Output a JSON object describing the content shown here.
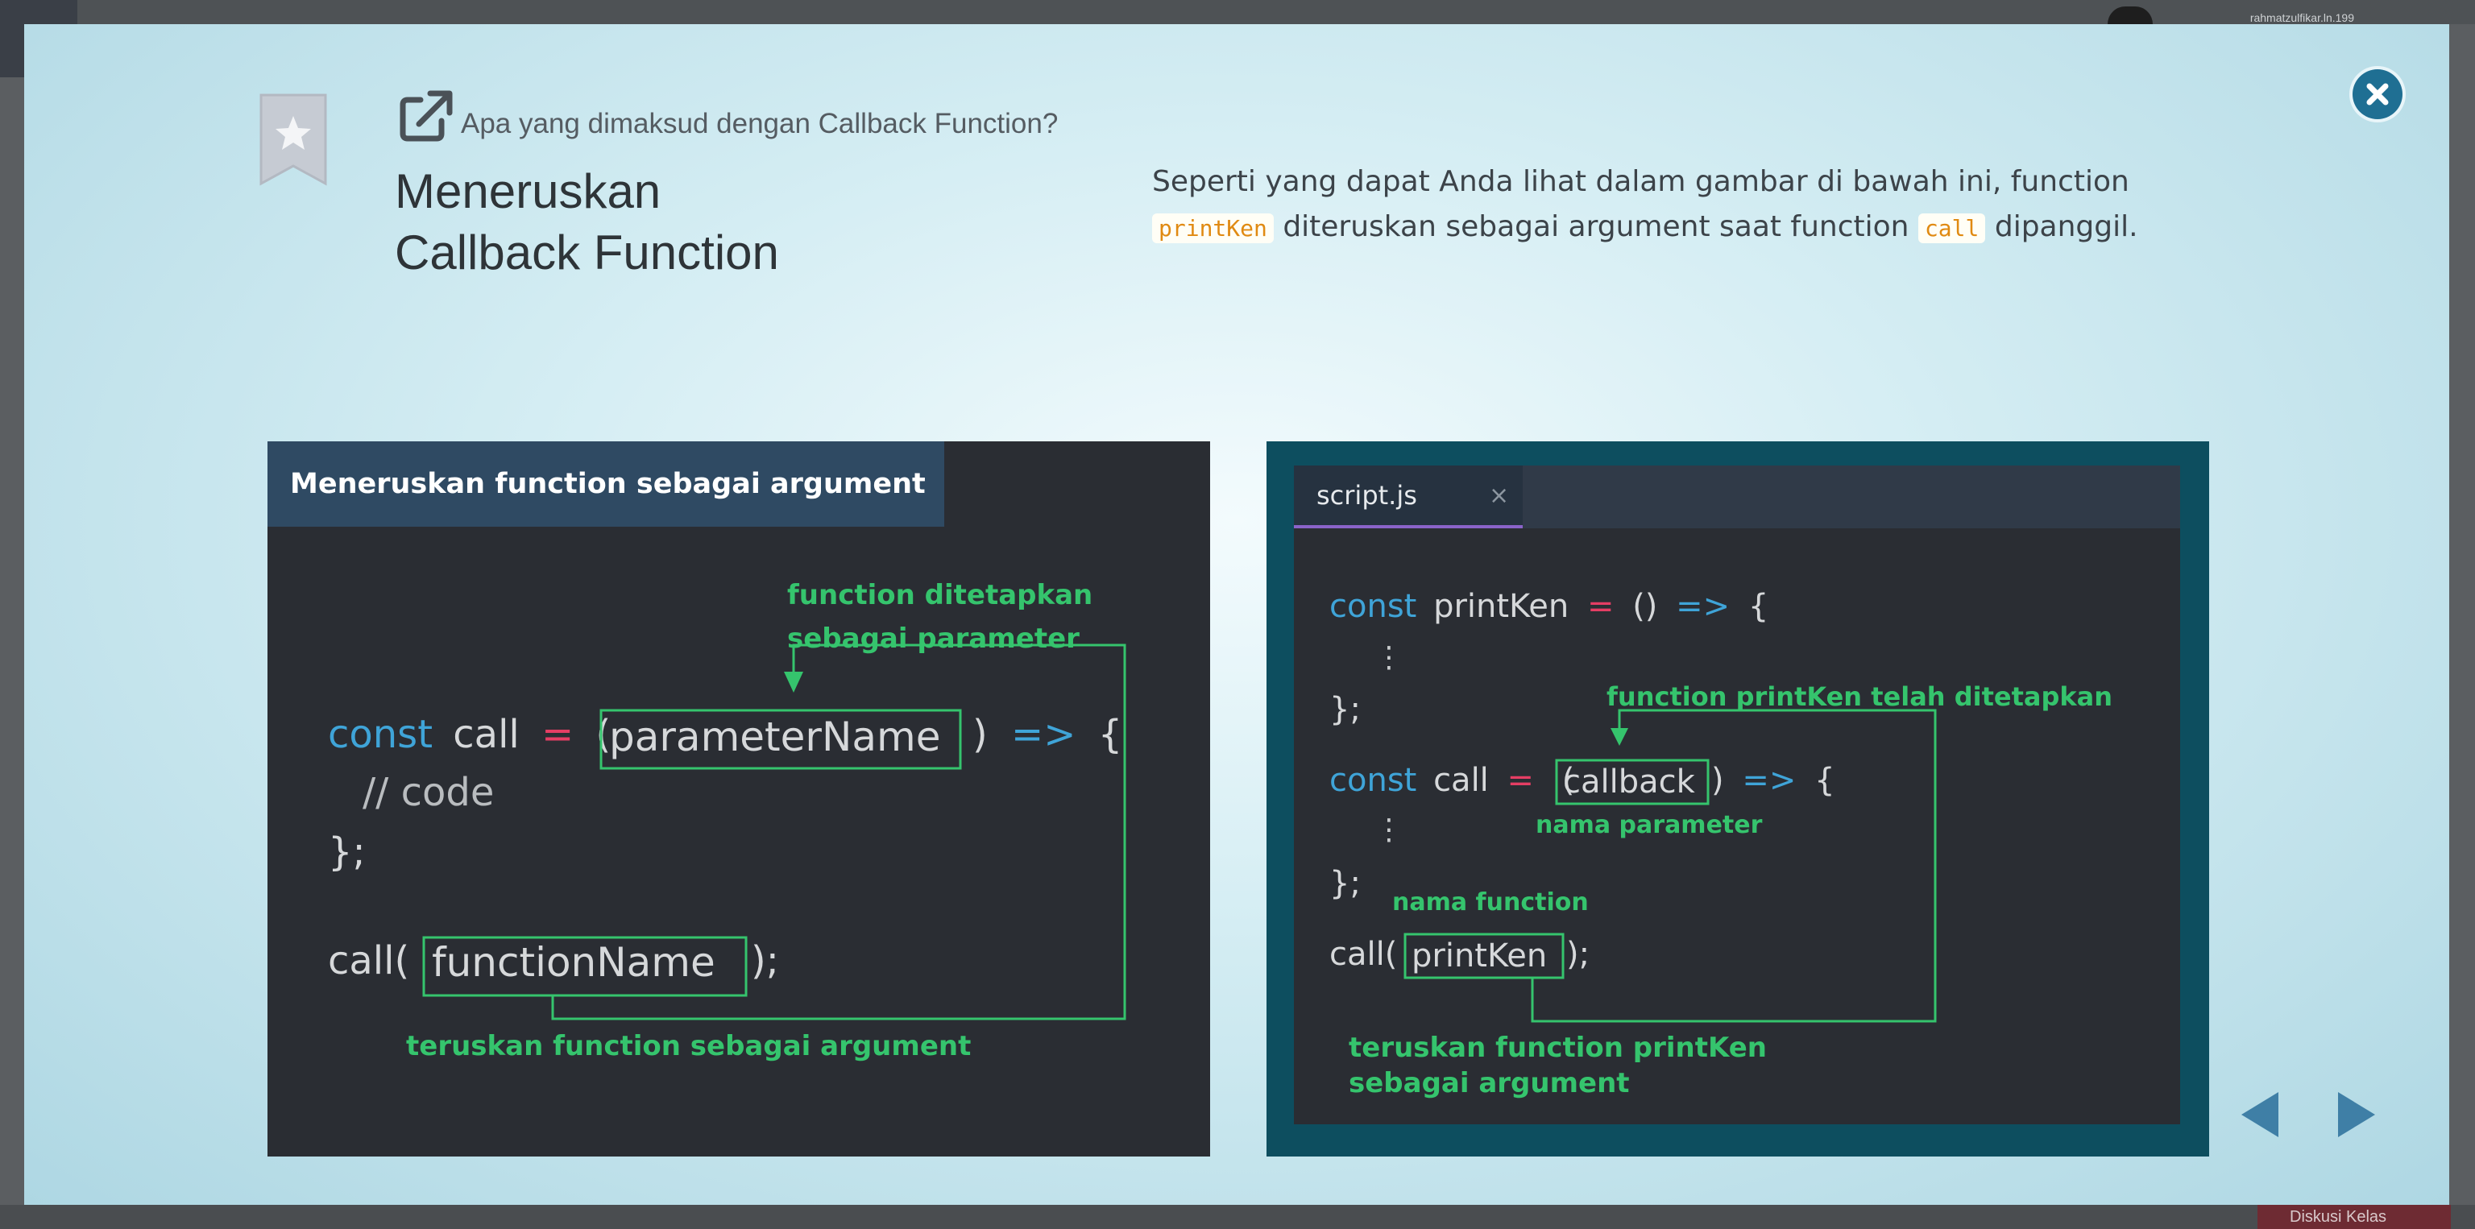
{
  "background": {
    "user_name": "rahmatzulfikar.ln.199",
    "discussion_button": "Diskusi Kelas"
  },
  "modal": {
    "question": "Apa yang dimaksud dengan Callback Function?",
    "title_line1": "Meneruskan",
    "title_line2": "Callback Function",
    "description": {
      "part1": "Seperti yang dapat Anda lihat dalam gambar di bawah ini, function",
      "code1": "printKen",
      "part2": "diteruskan sebagai argument saat function",
      "code2": "call",
      "part3": "dipanggil."
    }
  },
  "figure_left": {
    "header": "Meneruskan function sebagai argument",
    "code": {
      "kw_const": "const",
      "call_name": "call",
      "eq": "=",
      "paren_open": "(",
      "param": "parameterName",
      "paren_close": ")",
      "arrow": "=>",
      "brace_open": "{",
      "comment": "// code",
      "brace_close": "};",
      "call_open": "call(",
      "arg": "functionName",
      "call_close": ");"
    },
    "annotations": {
      "top_line1": "function ditetapkan",
      "top_line2": "sebagai parameter",
      "bottom": "teruskan function sebagai argument"
    }
  },
  "figure_right": {
    "tab_label": "script.js",
    "tab_close": "×",
    "code": {
      "kw_const": "const",
      "print_name": "printKen",
      "eq": "=",
      "empty_params": "()",
      "arrow": "=>",
      "brace_open": "{",
      "dots": "⋮",
      "brace_close": "};",
      "call_name": "call",
      "paren_open": "(",
      "param": "callback",
      "paren_close": ")",
      "call_open": "call(",
      "arg": "printKen",
      "call_close": ");"
    },
    "annotations": {
      "defined": "function printKen telah ditetapkan",
      "param_name": "nama parameter",
      "func_name": "nama function",
      "bottom_line1": "teruskan function printKen",
      "bottom_line2": "sebagai argument"
    }
  },
  "colors": {
    "accent_green": "#35c46d",
    "keyword_blue": "#3fa4d8",
    "operator_red": "#e53e64",
    "code_text": "#d6d8da",
    "close_button": "#1f6f93"
  },
  "icons": {
    "close": "close-icon",
    "bookmark": "bookmark-star-icon",
    "external": "external-link-icon",
    "prev": "arrow-left-icon",
    "next": "arrow-right-icon"
  }
}
